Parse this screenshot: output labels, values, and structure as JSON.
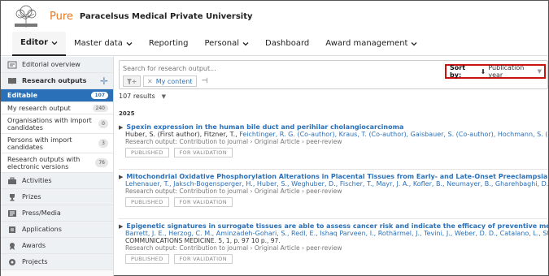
{
  "header": {
    "brand": "Pure",
    "organisation": "Paracelsus Medical Private University"
  },
  "nav": {
    "items": [
      {
        "label": "Editor",
        "dropdown": true,
        "active": true
      },
      {
        "label": "Master data",
        "dropdown": true
      },
      {
        "label": "Reporting",
        "dropdown": false
      },
      {
        "label": "Personal",
        "dropdown": true
      },
      {
        "label": "Dashboard",
        "dropdown": false
      },
      {
        "label": "Award management",
        "dropdown": true
      }
    ]
  },
  "sidebar": {
    "editorial_overview": "Editorial overview",
    "research_outputs": "Research outputs",
    "editable": {
      "label": "Editable",
      "count": "107"
    },
    "sub_items": [
      {
        "label": "My research output",
        "count": "240"
      },
      {
        "label": "Organisations with import candidates",
        "count": "0"
      },
      {
        "label": "Persons with import candidates",
        "count": "3"
      },
      {
        "label": "Research outputs with electronic versions",
        "count": "76"
      }
    ],
    "sections": [
      {
        "label": "Activities",
        "icon": "briefcase-icon"
      },
      {
        "label": "Prizes",
        "icon": "trophy-icon"
      },
      {
        "label": "Press/Media",
        "icon": "newspaper-icon"
      },
      {
        "label": "Applications",
        "icon": "applications-icon"
      },
      {
        "label": "Awards",
        "icon": "award-icon"
      },
      {
        "label": "Projects",
        "icon": "projects-icon"
      }
    ]
  },
  "search": {
    "placeholder": "Search for research output...",
    "filter_chip": "My content",
    "sort_label": "Sort by:",
    "sort_value": "Publication year"
  },
  "results": {
    "count_label": "107 results",
    "year": "2025",
    "items": [
      {
        "title": "Spexin expression in the human bile duct and perihilar cholangiocarcinoma",
        "authors_plain": "Huber, S. (First author), Fitzner, T.,",
        "authors_links": "Feichtinger, R. G. (Co-author), Kraus, T. (Co-author), Gaisbauer, S. (Co-author), Hochmann, S. (Co",
        "meta": "Research output: Contribution to journal › Original Article › peer-review",
        "tag1": "PUBLISHED",
        "tag2": "FOR VALIDATION"
      },
      {
        "title": "Mitochondrial Oxidative Phosphorylation Alterations in Placental Tissues from Early- and Late-Onset Preeclampsia",
        "authors_plain": "Lehenauer, T., Jaksch-Bogensperger, H., Huber, S., Weghuber, D., Fischer, T., Mayr, J. A., Kofler, B., Neumayer, B., Gharehbaghi, D., Dug",
        "authors_links": "",
        "meta": "Research output: Contribution to journal › Original Article › peer-review",
        "tag1": "PUBLISHED",
        "tag2": "FOR VALIDATION"
      },
      {
        "title": "Epigenetic signatures in surrogate tissues are able to assess cancer risk and indicate the efficacy of preventive measures",
        "authors_plain": "Barrett, J. E., Herzog, C. M., Aminzadeh-Gohari, S., Redl, E., Ishaq Parveen, I., Rothärmel, J., Tevini, J., Weber, D. D., Catalano, L., Stefar",
        "authors_links": "",
        "journal": "COMMUNICATIONS MEDICINE. 5, 1, p. 97 10 p., 97.",
        "meta": "Research output: Contribution to journal › Original Article › peer-review",
        "tag1": "PUBLISHED",
        "tag2": "FOR VALIDATION"
      }
    ]
  },
  "colors": {
    "brand_orange": "#e87722",
    "link_blue": "#2a70b8",
    "highlight_red": "#cc1111"
  }
}
